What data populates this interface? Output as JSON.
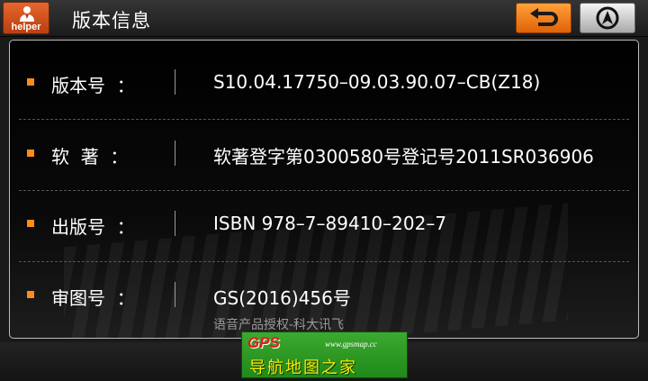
{
  "header": {
    "helper_label": "helper",
    "title": "版本信息",
    "back_icon": "back-arrow-icon",
    "nav_icon": "navigation-icon",
    "accent": "#f07a14"
  },
  "rows": [
    {
      "label": "版本号  ：",
      "value": "S10.04.17750–09.03.90.07–CB(Z18)"
    },
    {
      "label": "软  著  ：",
      "value": "软著登字第0300580号登记号2011SR036906"
    },
    {
      "label": "出版号  ：",
      "value": "ISBN 978–7–89410–202–7"
    },
    {
      "label": "审图号  ：",
      "value": "GS(2016)456号"
    }
  ],
  "subnote": "语音产品授权-科大讯飞",
  "watermark": {
    "logo": "GPS",
    "site": "www.gpsmap.cc",
    "brand": "导航地图之家"
  }
}
